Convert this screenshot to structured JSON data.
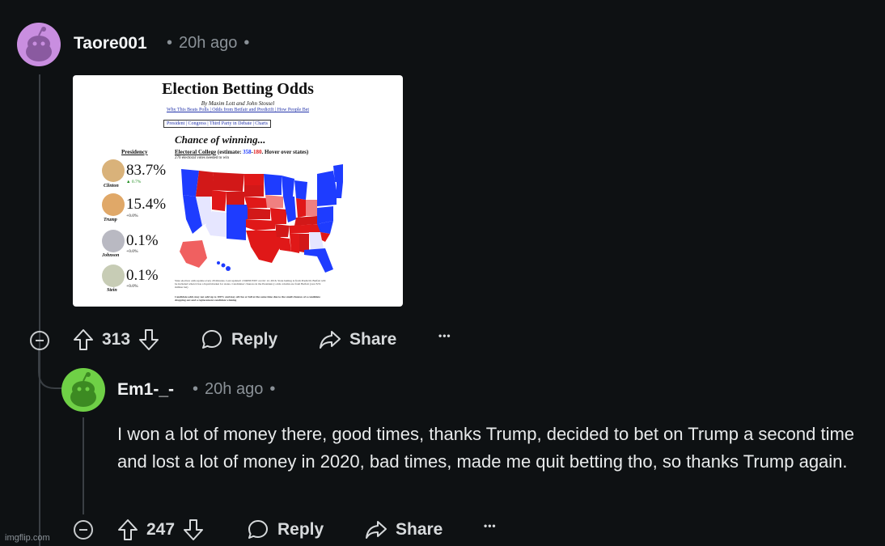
{
  "comments": [
    {
      "username": "Taore001",
      "time": "20h ago",
      "votes": "313",
      "reply_label": "Reply",
      "share_label": "Share",
      "more_label": "•••",
      "avatar_color": "#c98ee0",
      "embed": {
        "title": "Election Betting Odds",
        "byline": "By Maxim Lott and John Stossel",
        "links": "Why This Beats Polls | Odds from Betfair and PredictIt | How People Bet",
        "nav": "President | Congress | Third Party in Debate | Charts",
        "chance": "Chance of winning...",
        "presidency_label": "Presidency",
        "ec_label": "Electoral College",
        "ec_estimate_prefix": " (estimate: ",
        "ec_blue": "358",
        "ec_sep": "-",
        "ec_red": "180",
        "ec_suffix": ". Hover over states)",
        "needed": "270 electoral votes needed to win",
        "candidates": [
          {
            "name": "Clinton",
            "pct": "83.7%",
            "change": "▲ 0.7%",
            "face_color": "#d9b27a"
          },
          {
            "name": "Trump",
            "pct": "15.4%",
            "change": "+0.0%",
            "face_color": "#e0a868"
          },
          {
            "name": "Johnson",
            "pct": "0.1%",
            "change": "+0.0%",
            "face_color": "#b9b9c2"
          },
          {
            "name": "Stein",
            "pct": "0.1%",
            "change": "+0.0%",
            "face_color": "#c7ccb5"
          }
        ],
        "fine_print_1": "State election odds update every 20 minutes. Last updated: 2:04PM EDT on Oct 12, 2016. State betting is from PredictIt. Betfair will be included when it has a liquid market for states. Candidates' chances in the Presidency odds column are from Betfair (over $74 million bet)",
        "fine_print_2": "Candidate odds may not add up to 100% and may all rise or fall at the same time due to the small chances of a candidate dropping out and a replacement candidate winning",
        "colors": {
          "blue": "#1e3cff",
          "red": "#e01818"
        }
      }
    },
    {
      "username": "Em1-_-",
      "time": "20h ago",
      "text": "I won a lot of money there, good times, thanks Trump, decided to bet on Trump a second time and lost a lot of money in 2020, bad times, made me quit betting tho, so thanks Trump again.",
      "votes": "247",
      "reply_label": "Reply",
      "share_label": "Share",
      "more_label": "•••",
      "avatar_color": "#6fd046"
    }
  ],
  "watermark": "imgflip.com"
}
